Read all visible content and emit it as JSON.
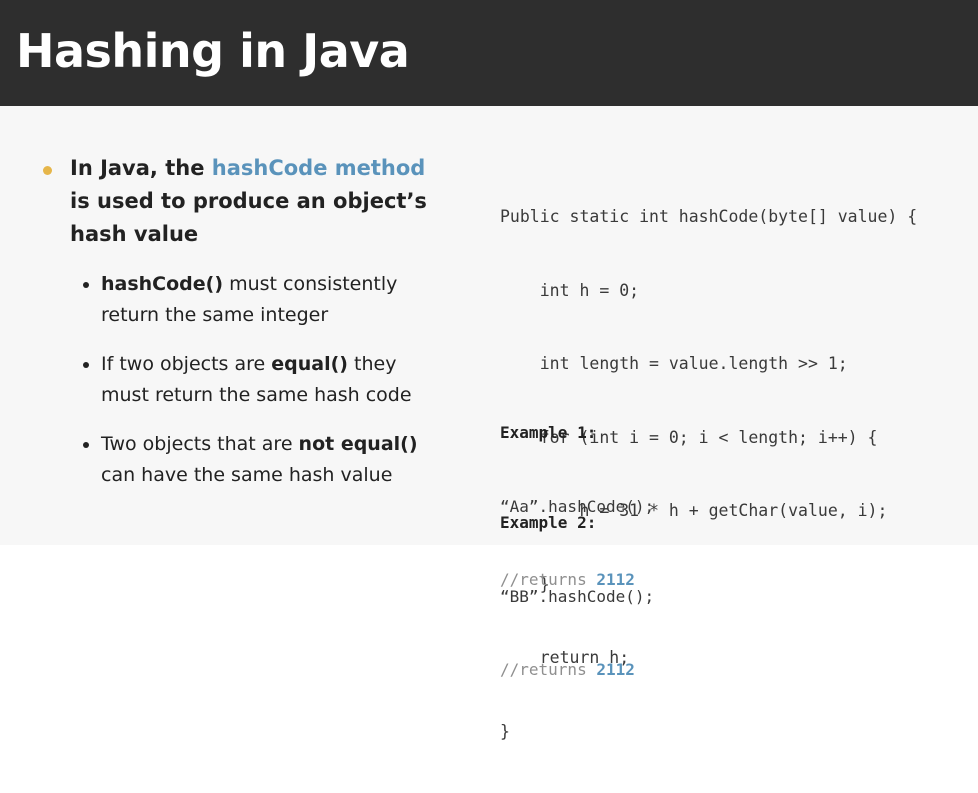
{
  "title": "Hashing in Java",
  "main_point": {
    "prefix": "In Java, the ",
    "highlight": "hashCode method",
    "rest": " is used to produce an object’s hash value"
  },
  "sub_points": [
    {
      "bold": "hashCode()",
      "text": " must consistently return the same integer"
    },
    {
      "pre": "If two objects are ",
      "bold": "equal()",
      "text": " they must return the same hash code"
    },
    {
      "pre": "Two objects that are ",
      "bold": "not equal()",
      "text": " can have the same hash value"
    }
  ],
  "code": [
    "Public static int hashCode(byte[] value) {",
    "    int h = 0;",
    "    int length = value.length >> 1;",
    "    for (int i = 0; i < length; i++) {",
    "        h = 31 * h + getChar(value, i);",
    "    }",
    "    return h;",
    "}"
  ],
  "examples": [
    {
      "header": "Example 1:",
      "call": "“Aa”.hashCode();",
      "comment": "//returns ",
      "result": "2112"
    },
    {
      "header": "Example 2:",
      "call": "“BB”.hashCode();",
      "comment": "//returns ",
      "result": "2112"
    }
  ],
  "colors": {
    "accent": "#5a93bb",
    "bullet": "#e6b64a",
    "title_bg": "#2e2e2e"
  }
}
